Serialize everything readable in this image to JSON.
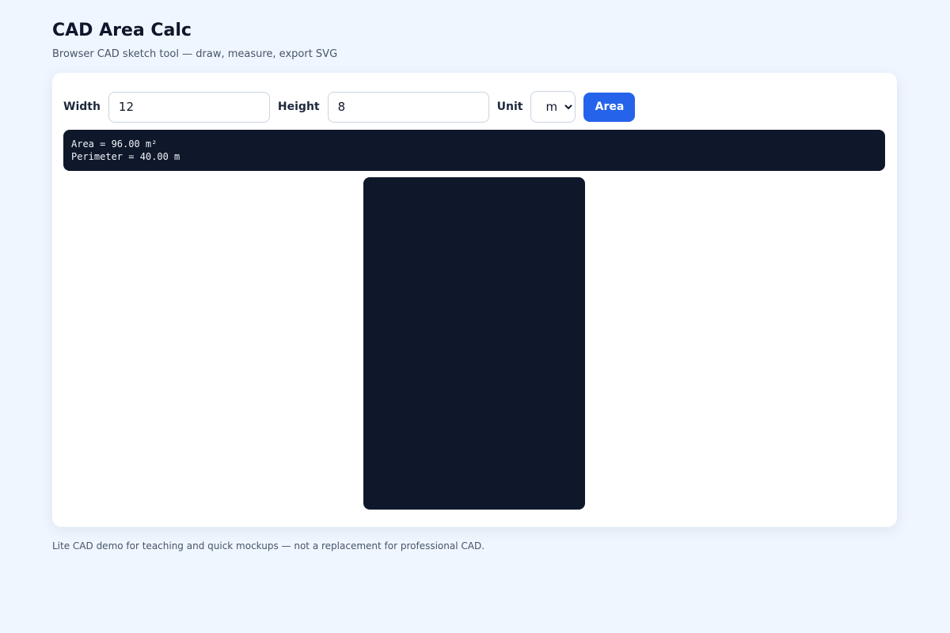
{
  "header": {
    "title": "CAD Area Calc",
    "subtitle": "Browser CAD sketch tool — draw, measure, export SVG"
  },
  "form": {
    "width_label": "Width",
    "width_value": "12",
    "height_label": "Height",
    "height_value": "8",
    "unit_label": "Unit",
    "unit_value": "m",
    "area_button": "Area"
  },
  "result": {
    "area_line": "Area = 96.00 m²",
    "perimeter_line": "Perimeter = 40.00 m"
  },
  "footer": {
    "note": "Lite CAD demo for teaching and quick mockups — not a replacement for professional CAD."
  },
  "colors": {
    "background": "#eff6ff",
    "card": "#ffffff",
    "accent": "#2563eb",
    "dark": "#0f172a"
  }
}
